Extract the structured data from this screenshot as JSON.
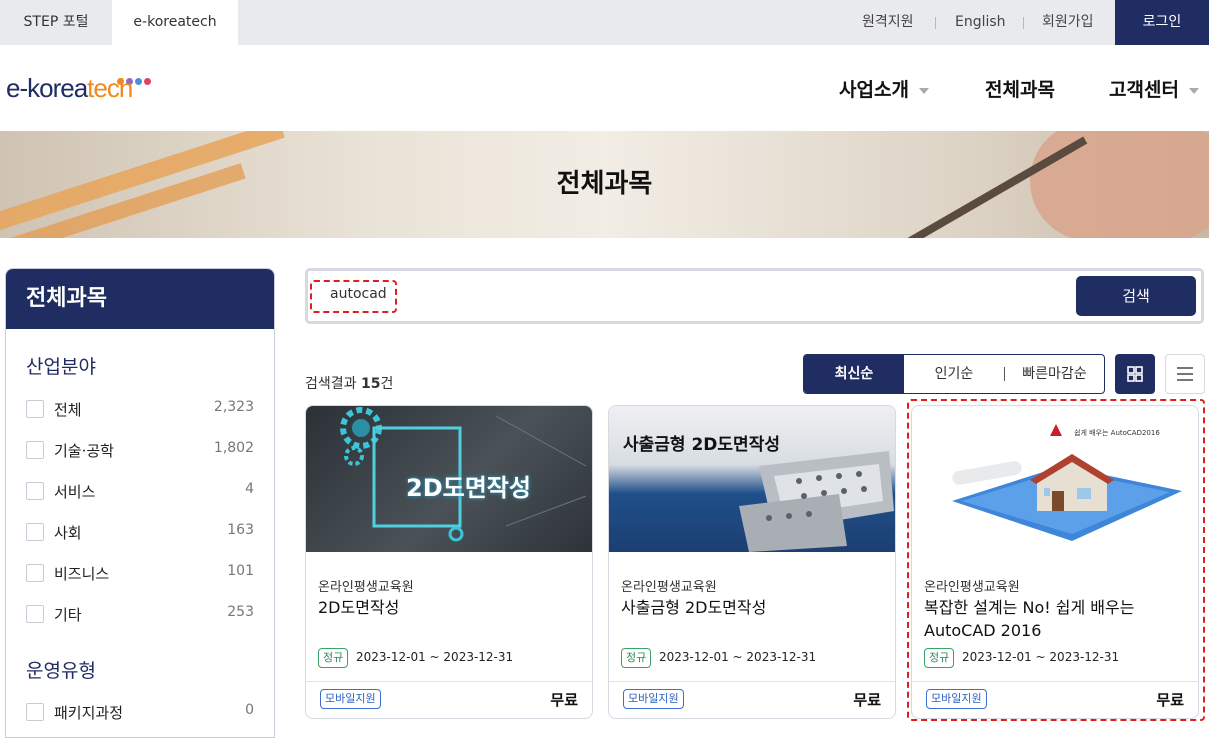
{
  "topbar": {
    "tabs": [
      "STEP 포털",
      "e-koreatech"
    ],
    "links": [
      "원격지원",
      "English",
      "회원가입"
    ],
    "login": "로그인"
  },
  "header": {
    "logo_main": "e-korea",
    "logo_accent": "tech",
    "nav": [
      "사업소개",
      "전체과목",
      "고객센터"
    ]
  },
  "banner": {
    "title": "전체과목"
  },
  "sidebar": {
    "title": "전체과목",
    "section1": "산업분야",
    "categories": [
      {
        "label": "전체",
        "count": "2,323"
      },
      {
        "label": "기술·공학",
        "count": "1,802"
      },
      {
        "label": "서비스",
        "count": "4"
      },
      {
        "label": "사회",
        "count": "163"
      },
      {
        "label": "비즈니스",
        "count": "101"
      },
      {
        "label": "기타",
        "count": "253"
      }
    ],
    "section2": "운영유형",
    "types": [
      {
        "label": "패키지과정",
        "count": "0"
      }
    ]
  },
  "search": {
    "value": "autocad",
    "button": "검색"
  },
  "results": {
    "label": "검색결과",
    "count": "15",
    "unit": "건",
    "sort": [
      "최신순",
      "인기순",
      "빠른마감순"
    ]
  },
  "cards": [
    {
      "thumb_text": "2D도면작성",
      "org": "온라인평생교육원",
      "title": "2D도면작성",
      "tag": "정규",
      "dates": "2023-12-01 ~ 2023-12-31",
      "mobile": "모바일지원",
      "price": "무료"
    },
    {
      "thumb_text": "사출금형 2D도면작성",
      "org": "온라인평생교육원",
      "title": "사출금형 2D도면작성",
      "tag": "정규",
      "dates": "2023-12-01 ~ 2023-12-31",
      "mobile": "모바일지원",
      "price": "무료"
    },
    {
      "thumb_text": "쉽게 배우는 AutoCAD2016",
      "org": "온라인평생교육원",
      "title": "복잡한 설계는 No! 쉽게 배우는 AutoCAD 2016",
      "tag": "정규",
      "dates": "2023-12-01 ~ 2023-12-31",
      "mobile": "모바일지원",
      "price": "무료"
    }
  ],
  "colors": {
    "navy": "#1f2d63",
    "orange": "#f08a1d",
    "highlight": "#e01e1e"
  }
}
